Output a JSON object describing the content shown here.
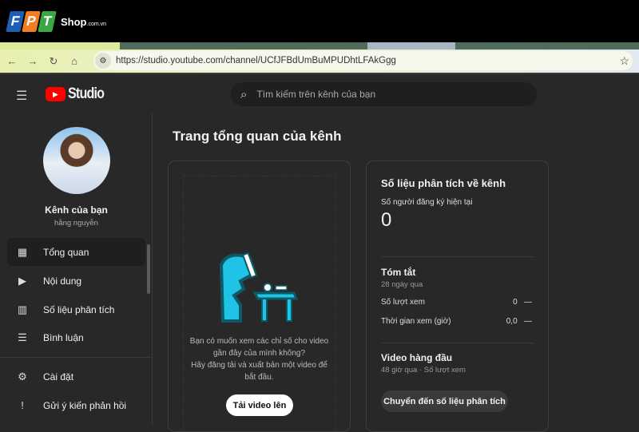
{
  "brand": {
    "letters": [
      "F",
      "P",
      "T"
    ],
    "shop": "Shop",
    "domain": ".com.vn"
  },
  "browser": {
    "url": "https://studio.youtube.com/channel/UCfJFBdUmBuMPUDhtLFAkGgg"
  },
  "header": {
    "logo": "Studio",
    "search_placeholder": "Tìm kiếm trên kênh của bạn"
  },
  "sidebar": {
    "channel_title": "Kênh của bạn",
    "channel_name": "hằng nguyễn",
    "items": [
      {
        "label": "Tổng quan",
        "icon": "dashboard-icon"
      },
      {
        "label": "Nội dung",
        "icon": "content-icon"
      },
      {
        "label": "Số liệu phân tích",
        "icon": "analytics-icon"
      },
      {
        "label": "Bình luận",
        "icon": "comments-icon"
      }
    ],
    "bottom": [
      {
        "label": "Cài đặt",
        "icon": "gear-icon"
      },
      {
        "label": "Gửi ý kiến phản hồi",
        "icon": "feedback-icon"
      }
    ]
  },
  "main": {
    "title": "Trang tổng quan của kênh",
    "upload_card": {
      "line1": "Bạn có muốn xem các chỉ số cho video",
      "line2": "gần đây của mình không?",
      "line3": "Hãy đăng tải và xuất bản một video để",
      "line4": "bắt đầu.",
      "button": "Tải video lên"
    },
    "analytics": {
      "title": "Số liệu phân tích về kênh",
      "subs_label": "Số người đăng ký hiện tại",
      "subs_value": "0",
      "summary_title": "Tóm tắt",
      "summary_period": "28 ngày qua",
      "rows": [
        {
          "label": "Số lượt xem",
          "value": "0",
          "trend": "—"
        },
        {
          "label": "Thời gian xem (giờ)",
          "value": "0,0",
          "trend": "—"
        }
      ],
      "top_title": "Video hàng đầu",
      "top_sub": "48 giờ qua · Số lượt xem",
      "button": "Chuyển đến số liệu phân tích"
    }
  }
}
